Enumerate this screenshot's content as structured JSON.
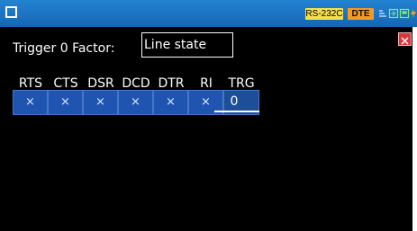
{
  "header": {
    "menu_icon": "square-icon",
    "badges": {
      "interface": "RS-232C",
      "mode": "DTE"
    },
    "status_icons": [
      "signal-icon",
      "port-icon",
      "save-icon",
      "power-icon"
    ]
  },
  "trigger": {
    "label": "Trigger 0 Factor:",
    "factor_value": "Line state"
  },
  "signals": {
    "headers": [
      "RTS",
      "CTS",
      "DSR",
      "DCD",
      "DTR",
      "RI",
      "TRG"
    ],
    "values": [
      "×",
      "×",
      "×",
      "×",
      "×",
      "×",
      "0"
    ]
  },
  "colors": {
    "top_bar": "#1a70c4",
    "cell": "#1f55b1",
    "close_button": "#d9363b",
    "badge_interface": "#f4e04d",
    "badge_mode": "#f59a23"
  }
}
